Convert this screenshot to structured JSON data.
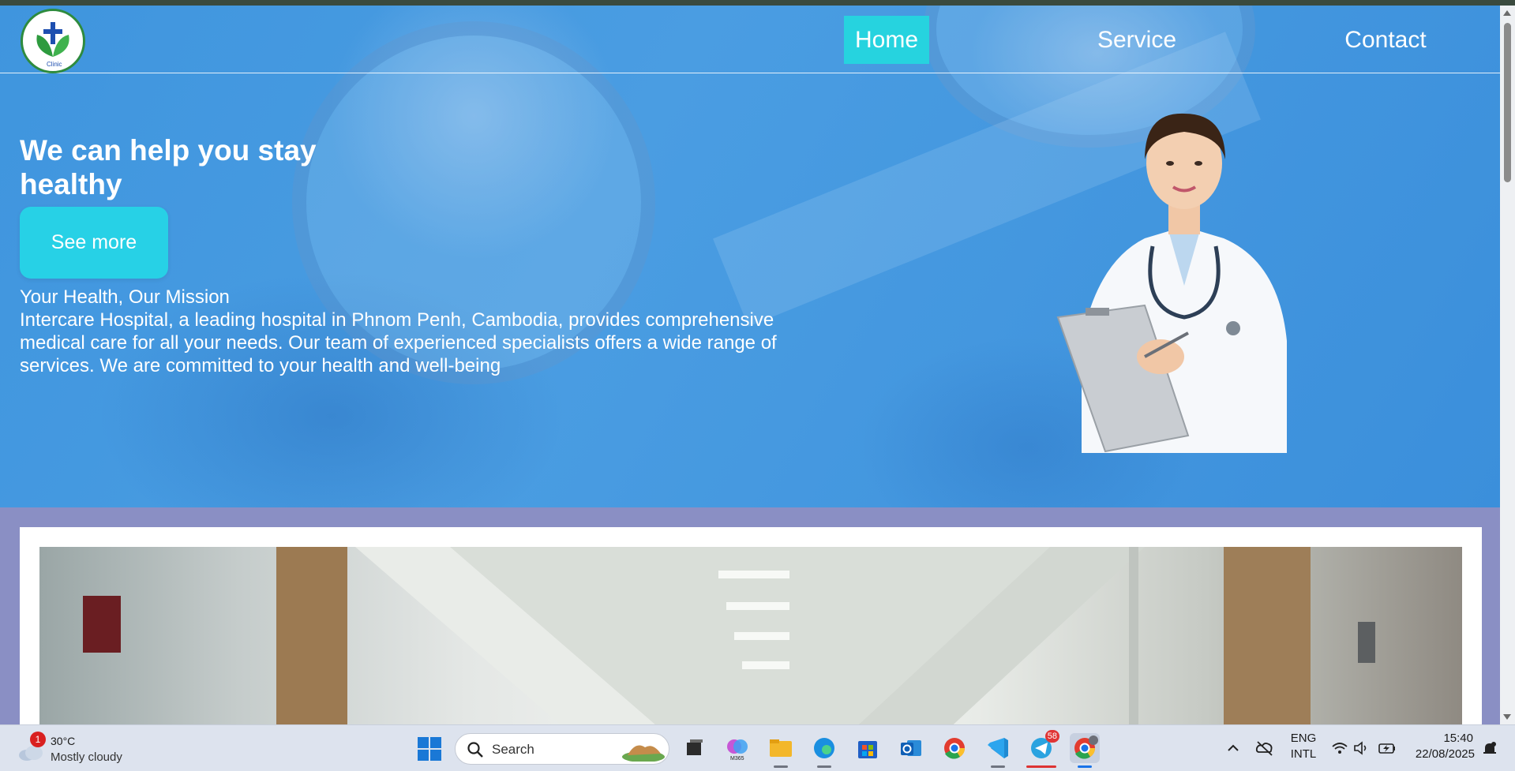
{
  "nav": {
    "logo_text": "Clinic",
    "links": [
      {
        "label": "Home",
        "active": true
      },
      {
        "label": "Service",
        "active": false
      },
      {
        "label": "Contact",
        "active": false
      }
    ]
  },
  "hero": {
    "headline": "We can help you stay healthy",
    "button_label": "See more",
    "mission_title": "Your Health, Our Mission",
    "mission_body": "Intercare Hospital, a leading hospital in Phnom Penh, Cambodia, provides comprehensive medical care for all your needs. Our team of experienced specialists offers a wide range of services. We are committed to your health and well-being"
  },
  "colors": {
    "hero_blue": "#4a9de2",
    "accent_cyan": "#26d3df",
    "section_bg": "#8a8fc4"
  },
  "taskbar": {
    "weather": {
      "badge": "1",
      "temp": "30°C",
      "condition": "Mostly cloudy"
    },
    "search_placeholder": "Search",
    "apps": [
      {
        "name": "task-view"
      },
      {
        "name": "m365",
        "label": "M365"
      },
      {
        "name": "file-explorer"
      },
      {
        "name": "edge"
      },
      {
        "name": "microsoft-store"
      },
      {
        "name": "outlook"
      },
      {
        "name": "chrome"
      },
      {
        "name": "vscode"
      },
      {
        "name": "telegram",
        "badge": "58"
      },
      {
        "name": "chrome-profile"
      }
    ],
    "language": "ENG",
    "layout": "INTL",
    "time": "15:40",
    "date": "22/08/2025"
  }
}
